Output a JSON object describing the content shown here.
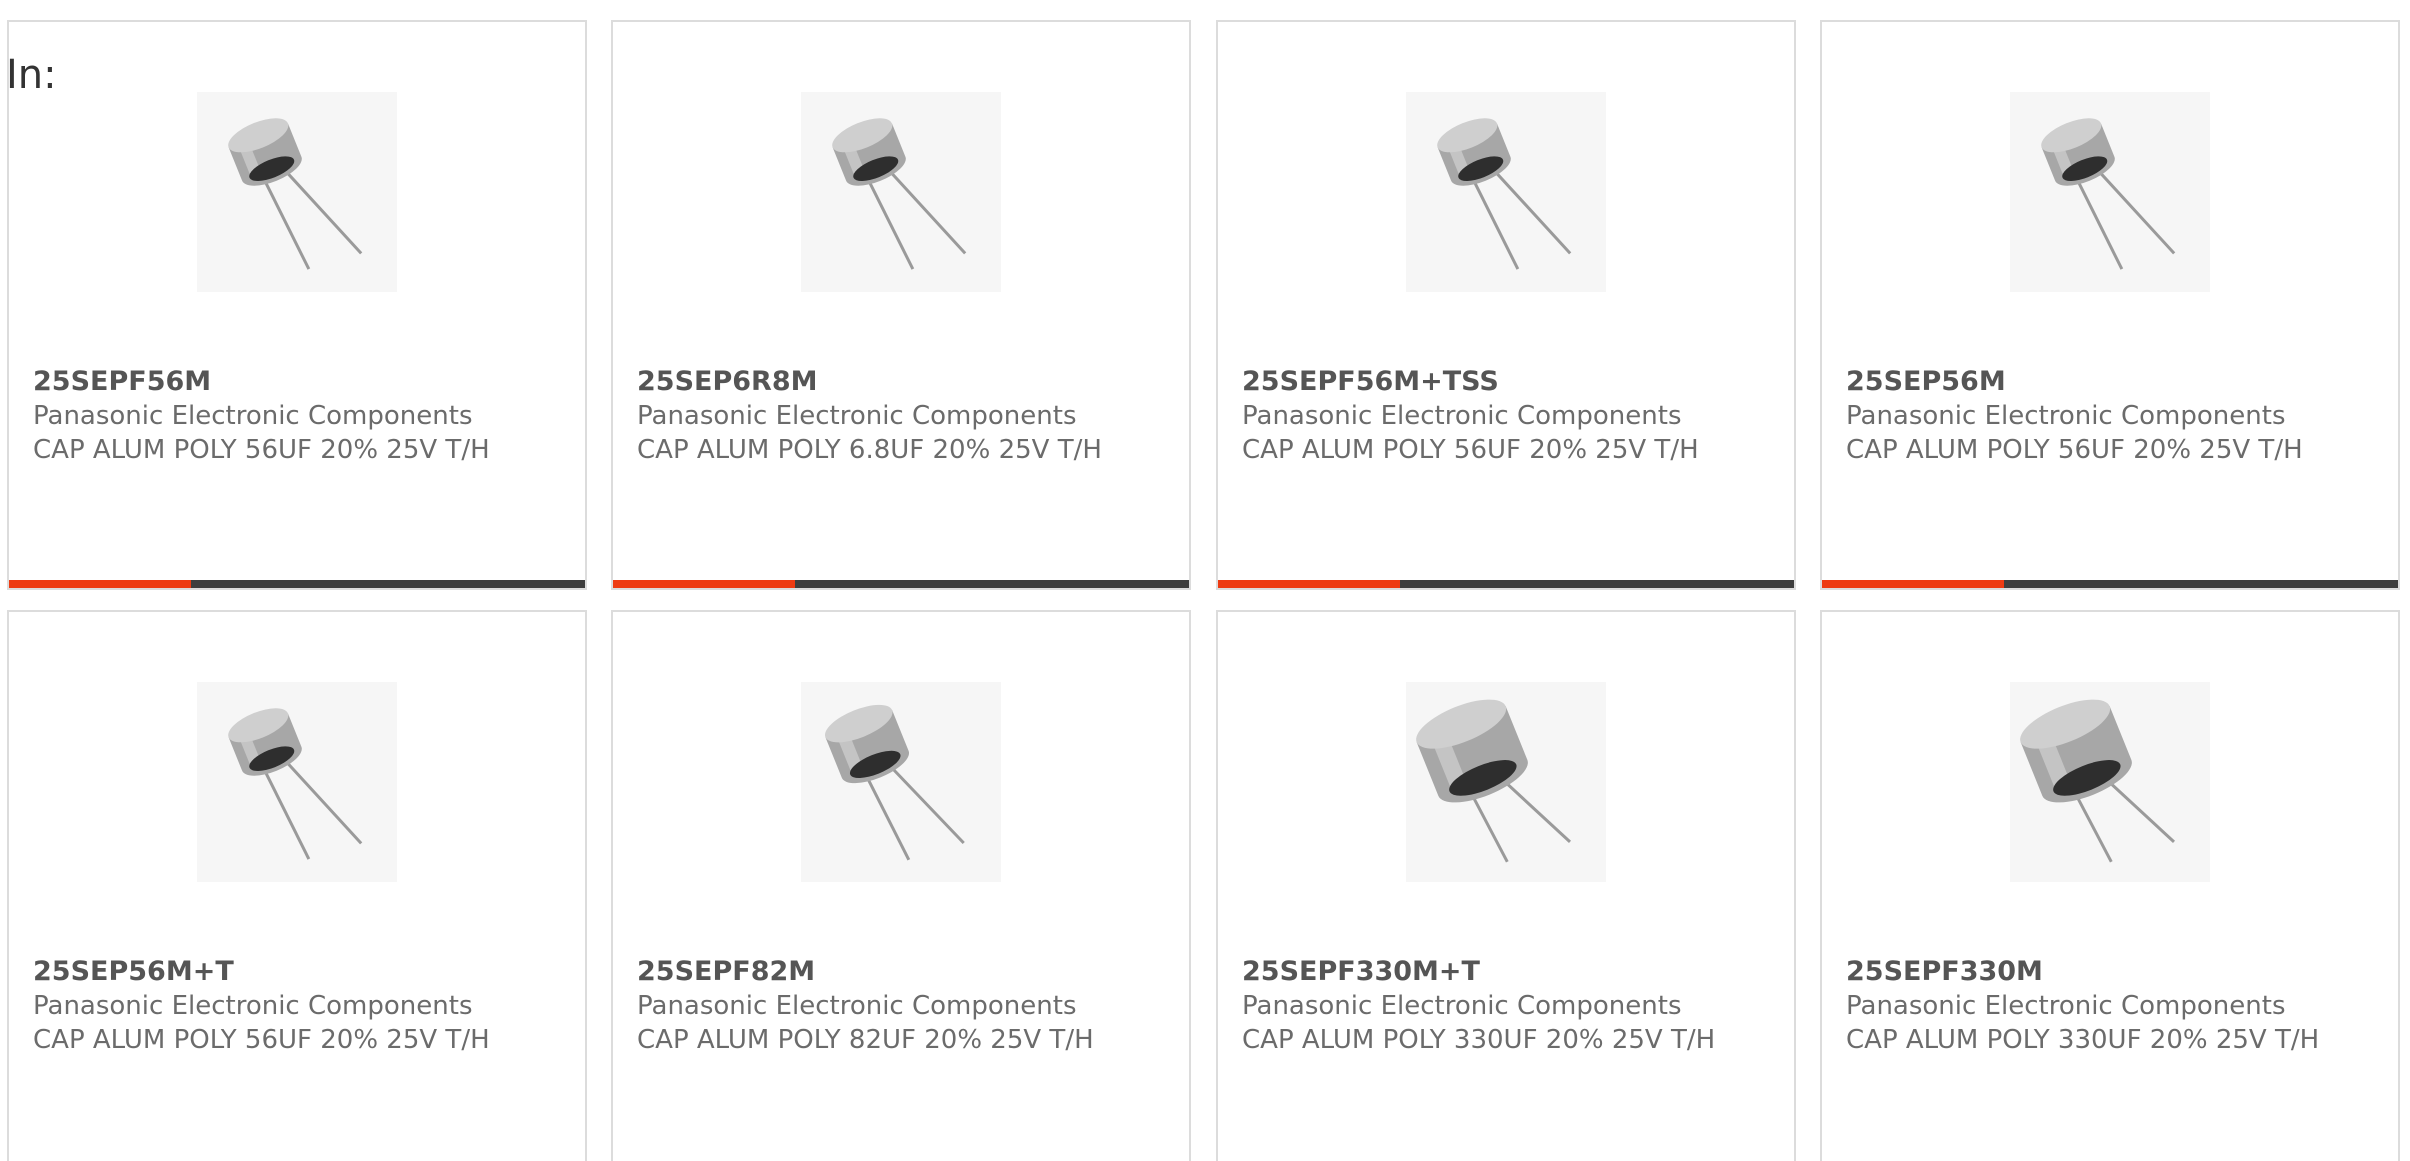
{
  "header": {
    "label": "In:"
  },
  "colors": {
    "accent": "#ee3b12",
    "track": "#3e3e3e",
    "border": "#dcdcdc"
  },
  "products": [
    {
      "part_number": "25SEPF56M",
      "manufacturer": "Panasonic Electronic Components",
      "description": "CAP ALUM POLY 56UF 20% 25V T/H",
      "icon": "capacitor-image",
      "progress": 0.316
    },
    {
      "part_number": "25SEP6R8M",
      "manufacturer": "Panasonic Electronic Components",
      "description": "CAP ALUM POLY 6.8UF 20% 25V T/H",
      "icon": "capacitor-image",
      "progress": 0.316
    },
    {
      "part_number": "25SEPF56M+TSS",
      "manufacturer": "Panasonic Electronic Components",
      "description": "CAP ALUM POLY 56UF 20% 25V T/H",
      "icon": "capacitor-image",
      "progress": 0.316
    },
    {
      "part_number": "25SEP56M",
      "manufacturer": "Panasonic Electronic Components",
      "description": "CAP ALUM POLY 56UF 20% 25V T/H",
      "icon": "capacitor-image",
      "progress": 0.316
    },
    {
      "part_number": "25SEP56M+T",
      "manufacturer": "Panasonic Electronic Components",
      "description": "CAP ALUM POLY 56UF 20% 25V T/H",
      "icon": "capacitor-image"
    },
    {
      "part_number": "25SEPF82M",
      "manufacturer": "Panasonic Electronic Components",
      "description": "CAP ALUM POLY 82UF 20% 25V T/H",
      "icon": "capacitor-image"
    },
    {
      "part_number": "25SEPF330M+T",
      "manufacturer": "Panasonic Electronic Components",
      "description": "CAP ALUM POLY 330UF 20% 25V T/H",
      "icon": "capacitor-image"
    },
    {
      "part_number": "25SEPF330M",
      "manufacturer": "Panasonic Electronic Components",
      "description": "CAP ALUM POLY 330UF 20% 25V T/H",
      "icon": "capacitor-image"
    }
  ]
}
